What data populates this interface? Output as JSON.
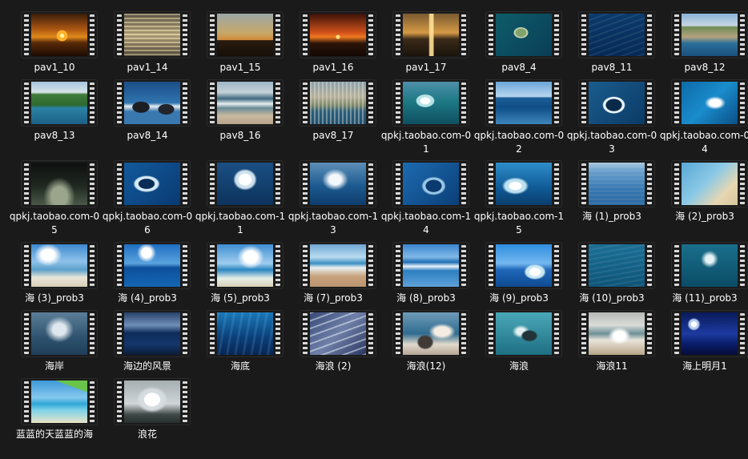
{
  "files": [
    {
      "name": "pav1_10",
      "thumb": "sunset-palm"
    },
    {
      "name": "pav1_14",
      "thumb": "golden-water"
    },
    {
      "name": "pav1_15",
      "thumb": "dusk-palms"
    },
    {
      "name": "pav1_16",
      "thumb": "red-sunset-horizon"
    },
    {
      "name": "pav1_17",
      "thumb": "golden-reflection"
    },
    {
      "name": "pav8_4",
      "thumb": "island-aerial"
    },
    {
      "name": "pav8_11",
      "thumb": "deep-blue-sea"
    },
    {
      "name": "pav8_12",
      "thumb": "coastal-town"
    },
    {
      "name": "pav8_13",
      "thumb": "green-cliff"
    },
    {
      "name": "pav8_14",
      "thumb": "rocky-shore"
    },
    {
      "name": "pav8_16",
      "thumb": "beach-waves"
    },
    {
      "name": "pav8_17",
      "thumb": "city-coast"
    },
    {
      "name": "qpkj.taobao.com-01",
      "thumb": "teal-wave"
    },
    {
      "name": "qpkj.taobao.com-02",
      "thumb": "open-sea-sky"
    },
    {
      "name": "qpkj.taobao.com-03",
      "thumb": "curling-wave"
    },
    {
      "name": "qpkj.taobao.com-04",
      "thumb": "blue-curl"
    },
    {
      "name": "qpkj.taobao.com-05",
      "thumb": "dark-wave"
    },
    {
      "name": "qpkj.taobao.com-06",
      "thumb": "barrel-wave"
    },
    {
      "name": "qpkj.taobao.com-11",
      "thumb": "white-crest"
    },
    {
      "name": "qpkj.taobao.com-13",
      "thumb": "spray-wave"
    },
    {
      "name": "qpkj.taobao.com-14",
      "thumb": "blue-barrel"
    },
    {
      "name": "qpkj.taobao.com-15",
      "thumb": "crashing-wave"
    },
    {
      "name": "海 (1)_prob3",
      "thumb": "calm-sea"
    },
    {
      "name": "海 (2)_prob3",
      "thumb": "shallow-water"
    },
    {
      "name": "海 (3)_prob3",
      "thumb": "sky-beach"
    },
    {
      "name": "海 (4)_prob3",
      "thumb": "blue-horizon"
    },
    {
      "name": "海 (5)_prob3",
      "thumb": "clouds-sea"
    },
    {
      "name": "海 (7)_prob3",
      "thumb": "sand-shore"
    },
    {
      "name": "海 (8)_prob3",
      "thumb": "surf-line"
    },
    {
      "name": "海 (9)_prob3",
      "thumb": "breaking-surf"
    },
    {
      "name": "海 (10)_prob3",
      "thumb": "teal-ripples"
    },
    {
      "name": "海 (11)_prob3",
      "thumb": "dark-teal-wave"
    },
    {
      "name": "海岸",
      "thumb": "silver-sea"
    },
    {
      "name": "海边的风景",
      "thumb": "evening-rocks"
    },
    {
      "name": "海底",
      "thumb": "underwater"
    },
    {
      "name": "海浪 (2)",
      "thumb": "foam-lines"
    },
    {
      "name": "海浪(12)",
      "thumb": "rocks-spray"
    },
    {
      "name": "海浪",
      "thumb": "teal-rocks"
    },
    {
      "name": "海浪11",
      "thumb": "beach-foam"
    },
    {
      "name": "海上明月1",
      "thumb": "night-moon"
    },
    {
      "name": "蓝蓝的天蓝蓝的海",
      "thumb": "palm-tropical"
    },
    {
      "name": "浪花",
      "thumb": "white-spray"
    }
  ],
  "thumb_styles": {
    "sunset-palm": "radial-gradient(circle at 55% 52%, #fff3a0 0 5%, #ffb02a 6% 14%, transparent 15%), linear-gradient(to bottom, #3a1c0a 0%, #b05a12 38%, #e08a1c 55%, #5a2a08 68%, #1c0c04 100%)",
    "golden-water": "repeating-linear-gradient(to bottom, rgba(255,240,190,0.35) 0 2px, rgba(0,0,0,0.15) 2px 5px), linear-gradient(to bottom, #6b6250, #c9b78a 50%, #5c5444)",
    "dusk-palms": "linear-gradient(to bottom, #9aa7a6 0%, #c7a86a 45%, #d08a3a 62%, #2a1a0c 63%, #14100a 100%)",
    "red-sunset-horizon": "radial-gradient(circle at 50% 55%, #ffe08a 0 5%, transparent 6%), linear-gradient(to bottom, #3a120a 0%, #d2521a 45%, #f07a20 55%, #2b1408 70%, #140804 100%)",
    "golden-reflection": "linear-gradient(90deg, transparent 46%, rgba(255,225,150,0.9) 48% 54%, transparent 56%), linear-gradient(to bottom, #7a5a30 0%, #d59a45 45%, #3b2a18 60%, #1a140c 100%)",
    "island-aerial": "radial-gradient(ellipse at 45% 45%, #7fa36a 0 12%, #bfcfb0 13% 16%, transparent 17%), linear-gradient(135deg, #0e5c6a, #0a3e56)",
    "deep-blue-sea": "repeating-linear-gradient(160deg, rgba(255,255,255,0.08) 0 2px, transparent 2px 7px), linear-gradient(to bottom, #0b3a6c, #062a55)",
    "coastal-town": "linear-gradient(to bottom, #8ab3d8 0%, #c7d6e2 28%, #6f8b55 32%, #b4a27e 55%, #2a6f9a 70%, #1c4f7c 100%)",
    "green-cliff": "linear-gradient(to bottom, #a7c6dc 0%, #d7e3ea 25%, #3f7a3a 30%, #2e6a30 55%, #2a82a4 62%, #1d5f86 100%)",
    "rocky-shore": "radial-gradient(ellipse at 30% 60%, #1b1f24 0 15%, transparent 16%), radial-gradient(ellipse at 75% 65%, #22262c 0 13%, transparent 14%), linear-gradient(to bottom, #1b4e86, #2f74b0 50%, #e6eef4 58%, #3a78b0 70%)",
    "beach-waves": "linear-gradient(to bottom, #9cb4c6 0%, #c7d3da 25%, #3f6a80 40%, #e8eef0 52%, #6a8a96 62%, #c9b9a0 80%, #b6a48a 100%)",
    "city-coast": "repeating-linear-gradient(90deg, rgba(230,230,220,0.4) 0 2px, transparent 2px 5px), linear-gradient(to bottom, #8aa0ad 0%, #b7b09a 35%, #7f8a6a 55%, #2c5f7c 70%, #1f4e6e 100%)",
    "teal-wave": "radial-gradient(ellipse at 40% 45%, #ffffff 0 10%, #b8e4e6 11% 18%, transparent 20%), linear-gradient(to bottom, #4e8fa8 0%, #1e7a86 45%, #0e4f60 100%)",
    "open-sea-sky": "linear-gradient(to bottom, #6aa6d8 0%, #b8d6ee 35%, #1d5f98 38%, #0f4d86 60%, #3e86bb 100%)",
    "curling-wave": "radial-gradient(ellipse at 45% 55%, #0a2a4a 0 18%, #e8f4fb 19% 24%, transparent 26%), linear-gradient(135deg, #1a5c8e, #0c3b66)",
    "blue-curl": "radial-gradient(ellipse at 60% 50%, #ffffff 0 12%, transparent 22%), linear-gradient(135deg, #0e6aa8, #1a8ccc 50%, #0b4f86)",
    "dark-wave": "radial-gradient(ellipse at 50% 80%, #9aa58c 0 20%, transparent 40%), linear-gradient(to bottom, #0e0f10 0%, #1f2820 55%, #4a5848 100%)",
    "barrel-wave": "radial-gradient(ellipse at 40% 50%, #0a2d56 0 16%, #d7ecf7 18% 24%, transparent 28%), linear-gradient(135deg, #125a9c, #0a3a72)",
    "white-crest": "radial-gradient(ellipse at 50% 40%, #ffffff 0 16%, #cfe2ee 17% 24%, transparent 30%), linear-gradient(to bottom, #1b4f84, #0c335c)",
    "spray-wave": "radial-gradient(ellipse at 45% 40%, #f3f8fb 0 14%, transparent 30%), linear-gradient(to bottom, #5d8fb8, #1d5a90 55%, #0e3d6c)",
    "blue-barrel": "radial-gradient(ellipse at 55% 55%, #0a3a6e 0 18%, #9cc8e6 19% 24%, transparent 28%), linear-gradient(135deg, #1d6bb0, #0b3f78)",
    "crashing-wave": "radial-gradient(ellipse at 35% 55%, #ffffff 0 12%, #bfe2f2 13% 20%, transparent 26%), linear-gradient(to bottom, #2e8ec9, #0f5a96 60%, #0b3e6e)",
    "calm-sea": "repeating-linear-gradient(to bottom, rgba(255,255,255,0.12) 0 1px, transparent 1px 5px), linear-gradient(to bottom, #a9c7e0 0%, #6aa0cc 20%, #3a7ab2 60%, #2c6aa2 100%)",
    "shallow-water": "linear-gradient(135deg, #58a8d6 0%, #8cc9e6 45%, #e6d7b2 75%, #d8c49a 100%)",
    "sky-beach": "radial-gradient(ellipse at 30% 25%, #ffffff 0 12%, transparent 25%), linear-gradient(to bottom, #3d89d0 0%, #8fc2ea 40%, #5ca0c9 60%, #e9e5d8 78%, #d8cfb8 100%)",
    "blue-horizon": "radial-gradient(ellipse at 40% 20%, #ffffff 0 10%, transparent 20%), linear-gradient(to bottom, #1f6fc2 0%, #5aa3de 45%, #0d4f9a 55%, #1467b6 100%)",
    "clouds-sea": "radial-gradient(ellipse at 60% 30%, #ffffff 0 14%, transparent 28%), linear-gradient(to bottom, #3f8ed2 0%, #9fcdf0 45%, #2a86c0 60%, #e6efe8 80%, #d9cfb7 100%)",
    "sand-shore": "linear-gradient(to bottom, #6fa5d4 0%, #b9dcef 30%, #3b8ec2 45%, #e8f1f4 55%, #c7a27c 75%, #b9946e 100%)",
    "surf-line": "linear-gradient(to bottom, #3b86d0 0%, #7fb8e6 30%, #1f6eb4 42%, #e9f3fa 52%, #2d7fc0 62%, #5fa2d8 100%)",
    "breaking-surf": "radial-gradient(ellipse at 70% 65%, #ffffff 0 10%, #cbe8f4 11% 16%, transparent 20%), linear-gradient(to bottom, #2f8ee0 0%, #74b8ef 45%, #1f66b8 60%, #0f4b92 100%)",
    "teal-ripples": "repeating-linear-gradient(170deg, rgba(255,255,255,0.08) 0 2px, transparent 2px 6px), linear-gradient(to bottom, #1b6f96, #0e5478)",
    "dark-teal-wave": "radial-gradient(ellipse at 50% 35%, #e3f3f6 0 10%, transparent 22%), linear-gradient(to bottom, #1a6f8c, #0b4c66)",
    "silver-sea": "radial-gradient(ellipse at 50% 40%, #dfe8ee 0 16%, transparent 36%), linear-gradient(to bottom, #5c7e98, #2e526e 60%, #1f3e58)",
    "evening-rocks": "linear-gradient(to bottom, #27406a 0%, #6f8fb8 30%, #0e2c5a 48%, #14366a 75%, #0b1c38 100%)",
    "underwater": "repeating-linear-gradient(100deg, rgba(180,230,255,0.12) 0 3px, transparent 3px 10px), linear-gradient(to bottom, #1a78b8, #0a3e78 60%, #062654)",
    "foam-lines": "repeating-linear-gradient(160deg, rgba(235,245,250,0.5) 0 2px, transparent 2px 9px), linear-gradient(135deg, #394a78, #6f7fa8 50%, #2a3660)",
    "rocks-spray": "radial-gradient(ellipse at 70% 45%, #f5ede3 0 14%, transparent 24%), radial-gradient(ellipse at 40% 70%, #3f3a36 0 14%, transparent 18%), linear-gradient(to bottom, #6f9bb8, #2f6c90 50%, #e0d8cc 75%, #b7a896)",
    "teal-rocks": "radial-gradient(ellipse at 60% 55%, #22343a 0 14%, transparent 18%), radial-gradient(ellipse at 45% 45%, #e3f1f2 0 10%, transparent 20%), linear-gradient(to bottom, #4aa8b8, #1e6f82)",
    "beach-foam": "radial-gradient(ellipse at 55% 55%, #ffffff 0 14%, transparent 26%), linear-gradient(to bottom, #b7b9b6 0%, #d9dcd8 30%, #6d8f96 50%, #e8e4da 65%, #b9a68a 100%)",
    "night-moon": "radial-gradient(circle at 22% 28%, #ffffff 0 5%, #b8cdf0 6% 9%, transparent 12%), linear-gradient(to bottom, #0a1a5a 0%, #1c3aa0 50%, #0a1c68 75%, #050d38 100%)",
    "palm-tropical": "linear-gradient(200deg, #6ac44a 0 18%, transparent 19%), linear-gradient(to bottom, #3e98d8 0%, #86c8ef 40%, #2fa7d6 55%, #7fd2e8 70%, #e8e4c8 100%)",
    "white-spray": "radial-gradient(ellipse at 50% 45%, #ffffff 0 20%, #d6dde0 21% 30%, transparent 40%), linear-gradient(to bottom, #a5aeb2, #d0d5d7 55%, #3f4a48 80%, #25302e)"
  }
}
